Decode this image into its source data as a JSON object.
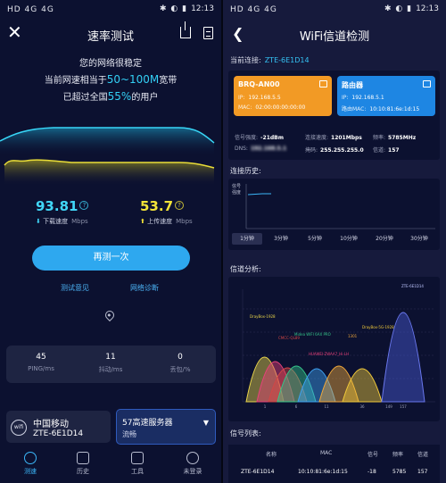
{
  "status": {
    "left": "HD 4G 4G",
    "right": "12:13"
  },
  "left": {
    "title": "速率测试",
    "summary": {
      "line1": "您的网络很稳定",
      "line2_pre": "当前网速相当于",
      "line2_big": "50~100M",
      "line2_post": "宽带",
      "line3_pre": "已超过全国",
      "line3_pct": "55%",
      "line3_post": "的用户"
    },
    "download": {
      "value": "93.81",
      "label": "下载速度",
      "unit": "Mbps"
    },
    "upload": {
      "value": "53.7",
      "label": "上传速度",
      "unit": "Mbps"
    },
    "retest_label": "再测一次",
    "link_feedback": "测试意见",
    "link_diagnose": "网络诊断",
    "stats": [
      {
        "value": "45",
        "label": "PING/ms"
      },
      {
        "value": "11",
        "label": "抖动/ms"
      },
      {
        "value": "0",
        "label": "丢包/%"
      }
    ],
    "carrier": {
      "badge": "wifi",
      "name": "中国移动",
      "ssid": "ZTE-6E1D14"
    },
    "server": {
      "name": "57高速服务器",
      "status": "流畅"
    },
    "tabs": [
      {
        "label": "测速",
        "icon": "gauge-icon"
      },
      {
        "label": "历史",
        "icon": "history-icon"
      },
      {
        "label": "工具",
        "icon": "toolbox-icon"
      },
      {
        "label": "未登录",
        "icon": "user-icon"
      }
    ]
  },
  "right": {
    "title": "WiFi信道检测",
    "current_label": "当前连接:",
    "current_ssid": "ZTE-6E1D14",
    "device1": {
      "name": "BRQ-AN00",
      "ip_label": "IP:",
      "ip": "192.168.5.5",
      "mac_label": "MAC:",
      "mac": "02:00:00:00:00:00"
    },
    "device2": {
      "name": "路由器",
      "ip_label": "IP:",
      "ip": "192.168.5.1",
      "mac_label": "路由MAC:",
      "mac": "10:10:81:6e:1d:15"
    },
    "signal": {
      "label": "信号强度:",
      "value": "-21dBm"
    },
    "speed": {
      "label": "连接速度:",
      "value": "1201Mbps"
    },
    "freq": {
      "label": "频率:",
      "value": "5785MHz"
    },
    "dns": {
      "label": "DNS:",
      "value": "192.168.5.1"
    },
    "mask": {
      "label": "掩码:",
      "value": "255.255.255.0"
    },
    "channel": {
      "label": "信道:",
      "value": "157"
    },
    "history_title": "连接历史:",
    "history_ylabel": "信号 强度",
    "time_chips": [
      "1分钟",
      "3分钟",
      "5分钟",
      "10分钟",
      "20分钟",
      "30分钟"
    ],
    "analysis_title": "信道分析:",
    "channel_axis": [
      "1",
      "6",
      "11",
      "36",
      "149",
      "157"
    ],
    "ap_labels": [
      "ZTE-6E1D14",
      "DrayBox-1928",
      "CMCC-QL89",
      "Midea WIFI 6AX PRO",
      "1301",
      "DrayBox-5G-1928",
      "HUAWEI-ZWAA7_Hi-LH"
    ],
    "list_title": "信号列表:",
    "list_headers": [
      "名称",
      "MAC",
      "信号",
      "频率",
      "信道"
    ],
    "list_row": [
      "ZTE-6E1D14",
      "10:10:81:6e:1d:15",
      "-18",
      "5785",
      "157"
    ]
  }
}
